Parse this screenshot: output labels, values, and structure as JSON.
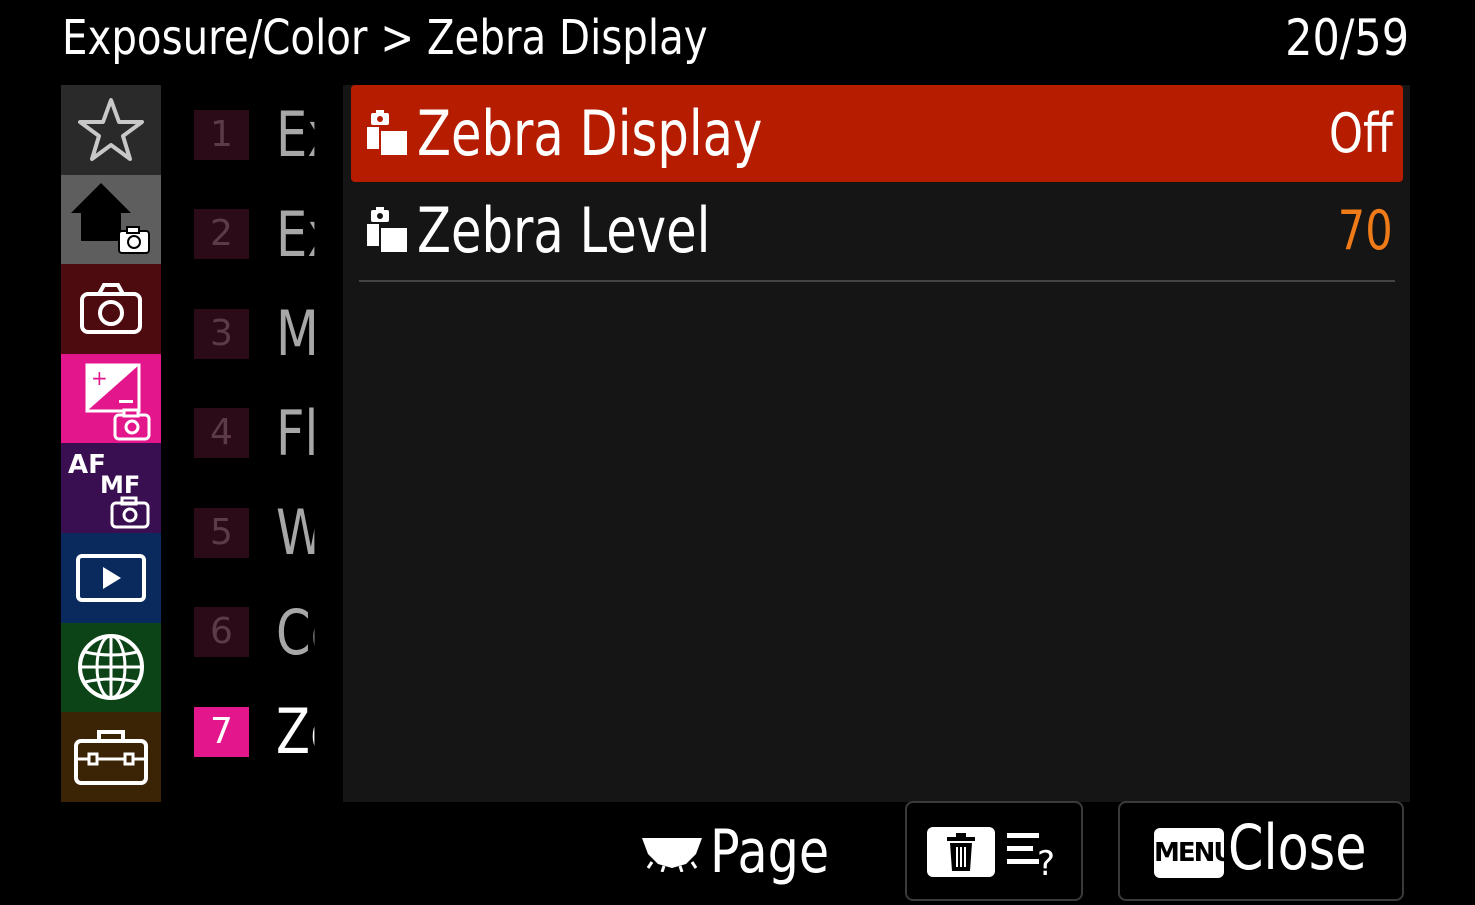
{
  "header": {
    "breadcrumb": "Exposure/Color > Zebra Display",
    "page_indicator": "20/59"
  },
  "categories": [
    {
      "name": "my-menu",
      "icon": "star-icon",
      "bg": "#2a2a2a"
    },
    {
      "name": "main",
      "icon": "home-camera-icon",
      "bg": "#5e5e5e"
    },
    {
      "name": "shooting",
      "icon": "camera-icon",
      "bg": "#4d0a0f"
    },
    {
      "name": "exposure-color",
      "icon": "exposure-camera-icon",
      "bg": "#e3168c",
      "selected": true
    },
    {
      "name": "focus",
      "icon": "af-mf-camera-icon",
      "bg": "#3a0f52"
    },
    {
      "name": "playback",
      "icon": "play-icon",
      "bg": "#0a2a5e"
    },
    {
      "name": "network",
      "icon": "globe-icon",
      "bg": "#0c4418"
    },
    {
      "name": "setup",
      "icon": "toolbox-icon",
      "bg": "#3b2406"
    }
  ],
  "af_mf_text": {
    "af": "AF",
    "mf": "MF"
  },
  "pages": [
    {
      "num": "1",
      "label": "Ex"
    },
    {
      "num": "2",
      "label": "Ex"
    },
    {
      "num": "3",
      "label": "M"
    },
    {
      "num": "4",
      "label": "Fl"
    },
    {
      "num": "5",
      "label": "W"
    },
    {
      "num": "6",
      "label": "Co"
    },
    {
      "num": "7",
      "label": "Ze",
      "active": true
    }
  ],
  "items": [
    {
      "label": "Zebra Display",
      "value": "Off",
      "selected": true
    },
    {
      "label": "Zebra Level",
      "value": "70"
    }
  ],
  "footer": {
    "page_label": "Page",
    "menu_badge": "MENU",
    "close_label": "Close"
  },
  "colors": {
    "selection": "#b51c00",
    "accent_magenta": "#e3168c",
    "value_orange": "#ef7b18"
  }
}
